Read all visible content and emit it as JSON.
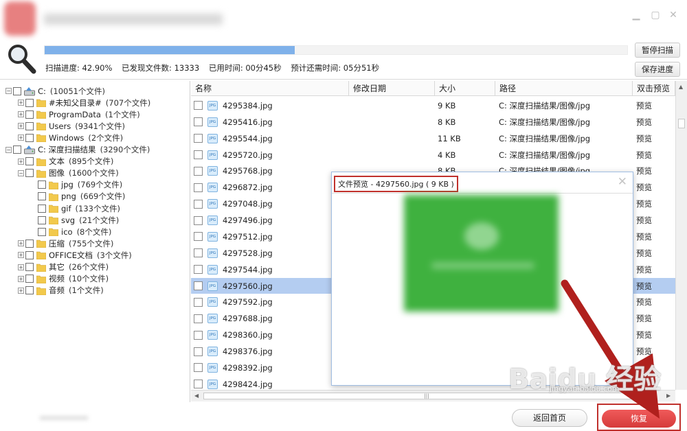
{
  "window": {
    "min_icon": "minimize-icon",
    "max_icon": "maximize-icon",
    "close_icon": "close-icon"
  },
  "scan": {
    "progress_label": "扫描进度: 42.90%",
    "progress_value": 0.429,
    "found_label": "已发现文件数: 13333",
    "elapsed_label": "已用时间: 00分45秒",
    "remaining_label": "预计还需时间: 05分51秒",
    "pause_button": "暂停扫描",
    "save_button": "保存进度"
  },
  "tree": [
    {
      "label": "C:",
      "count": "(10051个文件)",
      "level": 0,
      "type": "drive",
      "exp": "−"
    },
    {
      "label": "#未知父目录#",
      "count": "(707个文件)",
      "level": 1,
      "type": "folder",
      "exp": "+"
    },
    {
      "label": "ProgramData",
      "count": "(1个文件)",
      "level": 1,
      "type": "folder",
      "exp": "+"
    },
    {
      "label": "Users",
      "count": "(9341个文件)",
      "level": 1,
      "type": "folder",
      "exp": "+"
    },
    {
      "label": "Windows",
      "count": "(2个文件)",
      "level": 1,
      "type": "folder",
      "exp": "+"
    },
    {
      "label": "C: 深度扫描结果",
      "count": "(3290个文件)",
      "level": 0,
      "type": "drive",
      "exp": "−"
    },
    {
      "label": "文本",
      "count": "(895个文件)",
      "level": 1,
      "type": "folder",
      "exp": "+"
    },
    {
      "label": "图像",
      "count": "(1600个文件)",
      "level": 1,
      "type": "folder",
      "exp": "−"
    },
    {
      "label": "jpg",
      "count": "(769个文件)",
      "level": 2,
      "type": "folder",
      "exp": ""
    },
    {
      "label": "png",
      "count": "(669个文件)",
      "level": 2,
      "type": "folder",
      "exp": ""
    },
    {
      "label": "gif",
      "count": "(133个文件)",
      "level": 2,
      "type": "folder",
      "exp": ""
    },
    {
      "label": "svg",
      "count": "(21个文件)",
      "level": 2,
      "type": "folder",
      "exp": ""
    },
    {
      "label": "ico",
      "count": "(8个文件)",
      "level": 2,
      "type": "folder",
      "exp": ""
    },
    {
      "label": "压缩",
      "count": "(755个文件)",
      "level": 1,
      "type": "folder",
      "exp": "+"
    },
    {
      "label": "OFFICE文档",
      "count": "(3个文件)",
      "level": 1,
      "type": "folder",
      "exp": "+"
    },
    {
      "label": "其它",
      "count": "(26个文件)",
      "level": 1,
      "type": "folder",
      "exp": "+"
    },
    {
      "label": "视频",
      "count": "(10个文件)",
      "level": 1,
      "type": "folder",
      "exp": "+"
    },
    {
      "label": "音频",
      "count": "(1个文件)",
      "level": 1,
      "type": "folder",
      "exp": "+"
    }
  ],
  "list": {
    "columns": [
      "名称",
      "修改日期",
      "大小",
      "路径",
      "双击预览"
    ],
    "rows": [
      {
        "name": "4295384.jpg",
        "date": "",
        "size": "9 KB",
        "path": "C: 深度扫描结果/图像/jpg",
        "preview": "预览"
      },
      {
        "name": "4295416.jpg",
        "date": "",
        "size": "8 KB",
        "path": "C: 深度扫描结果/图像/jpg",
        "preview": "预览"
      },
      {
        "name": "4295544.jpg",
        "date": "",
        "size": "11 KB",
        "path": "C: 深度扫描结果/图像/jpg",
        "preview": "预览"
      },
      {
        "name": "4295720.jpg",
        "date": "",
        "size": "4 KB",
        "path": "C: 深度扫描结果/图像/jpg",
        "preview": "预览"
      },
      {
        "name": "4295768.jpg",
        "date": "",
        "size": "8 KB",
        "path": "C: 深度扫描结果/图像/jpg",
        "preview": "预览"
      },
      {
        "name": "4296872.jpg",
        "date": "",
        "size": "",
        "path": "",
        "preview": "预览"
      },
      {
        "name": "4297048.jpg",
        "date": "",
        "size": "",
        "path": "",
        "preview": "预览"
      },
      {
        "name": "4297496.jpg",
        "date": "",
        "size": "",
        "path": "",
        "preview": "预览"
      },
      {
        "name": "4297512.jpg",
        "date": "",
        "size": "",
        "path": "",
        "preview": "预览"
      },
      {
        "name": "4297528.jpg",
        "date": "",
        "size": "",
        "path": "",
        "preview": "预览"
      },
      {
        "name": "4297544.jpg",
        "date": "",
        "size": "",
        "path": "",
        "preview": "预览"
      },
      {
        "name": "4297560.jpg",
        "date": "",
        "size": "",
        "path": "",
        "preview": "预览",
        "selected": true
      },
      {
        "name": "4297592.jpg",
        "date": "",
        "size": "",
        "path": "",
        "preview": "预览"
      },
      {
        "name": "4297688.jpg",
        "date": "",
        "size": "",
        "path": "",
        "preview": "预览"
      },
      {
        "name": "4298360.jpg",
        "date": "",
        "size": "",
        "path": "",
        "preview": "预览"
      },
      {
        "name": "4298376.jpg",
        "date": "",
        "size": "",
        "path": "",
        "preview": "预览"
      },
      {
        "name": "4298392.jpg",
        "date": "",
        "size": "",
        "path": "",
        "preview": "预览"
      },
      {
        "name": "4298424.jpg",
        "date": "",
        "size": "",
        "path": "",
        "preview": "预览"
      }
    ],
    "file_icon_text": "JPG"
  },
  "preview_dialog": {
    "title": "文件预览 - 4297560.jpg ( 9 KB )",
    "close_glyph": "✕"
  },
  "footer": {
    "home_button": "返回首页",
    "recover_button": "恢复"
  },
  "watermark": {
    "text": "Baidu 经验",
    "sub": "jingyan.baidu.com"
  },
  "colors": {
    "accent_red": "#d63b3b",
    "progress": "#7fb1ea",
    "selected_row": "#b4cdf1",
    "highlight_box": "#c0302c"
  }
}
